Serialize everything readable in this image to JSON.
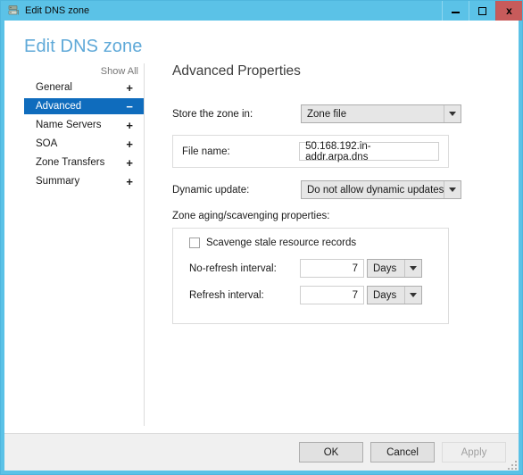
{
  "window": {
    "title": "Edit DNS zone",
    "icon": "dns-zone-icon",
    "accent_color": "#5BC2E7",
    "close_color": "#C75B5B",
    "controls": {
      "minimize": "minimize-icon",
      "maximize": "maximize-icon",
      "close": "close-icon",
      "close_label": "x"
    }
  },
  "page": {
    "heading": "Edit DNS zone",
    "heading_color": "#5FA9D8"
  },
  "nav": {
    "show_all": "Show All",
    "selected_color": "#0F6CBD",
    "items": [
      {
        "label": "General",
        "sign": "+",
        "expanded": false,
        "selected": false
      },
      {
        "label": "Advanced",
        "sign": "−",
        "expanded": true,
        "selected": true
      },
      {
        "label": "Name Servers",
        "sign": "+",
        "expanded": false,
        "selected": false
      },
      {
        "label": "SOA",
        "sign": "+",
        "expanded": false,
        "selected": false
      },
      {
        "label": "Zone Transfers",
        "sign": "+",
        "expanded": false,
        "selected": false
      },
      {
        "label": "Summary",
        "sign": "+",
        "expanded": false,
        "selected": false
      }
    ]
  },
  "content": {
    "title": "Advanced Properties",
    "store_zone": {
      "label": "Store the zone in:",
      "value": "Zone file"
    },
    "file_name": {
      "label": "File name:",
      "value": "50.168.192.in-addr.arpa.dns"
    },
    "dynamic_update": {
      "label": "Dynamic update:",
      "value": "Do not allow dynamic updates"
    },
    "aging": {
      "group_label": "Zone aging/scavenging properties:",
      "scavenge": {
        "label": "Scavenge stale resource records",
        "checked": false
      },
      "no_refresh": {
        "label": "No-refresh interval:",
        "value": "7",
        "unit": "Days"
      },
      "refresh": {
        "label": "Refresh interval:",
        "value": "7",
        "unit": "Days"
      }
    }
  },
  "footer": {
    "ok": "OK",
    "cancel": "Cancel",
    "apply": "Apply",
    "apply_enabled": false
  }
}
